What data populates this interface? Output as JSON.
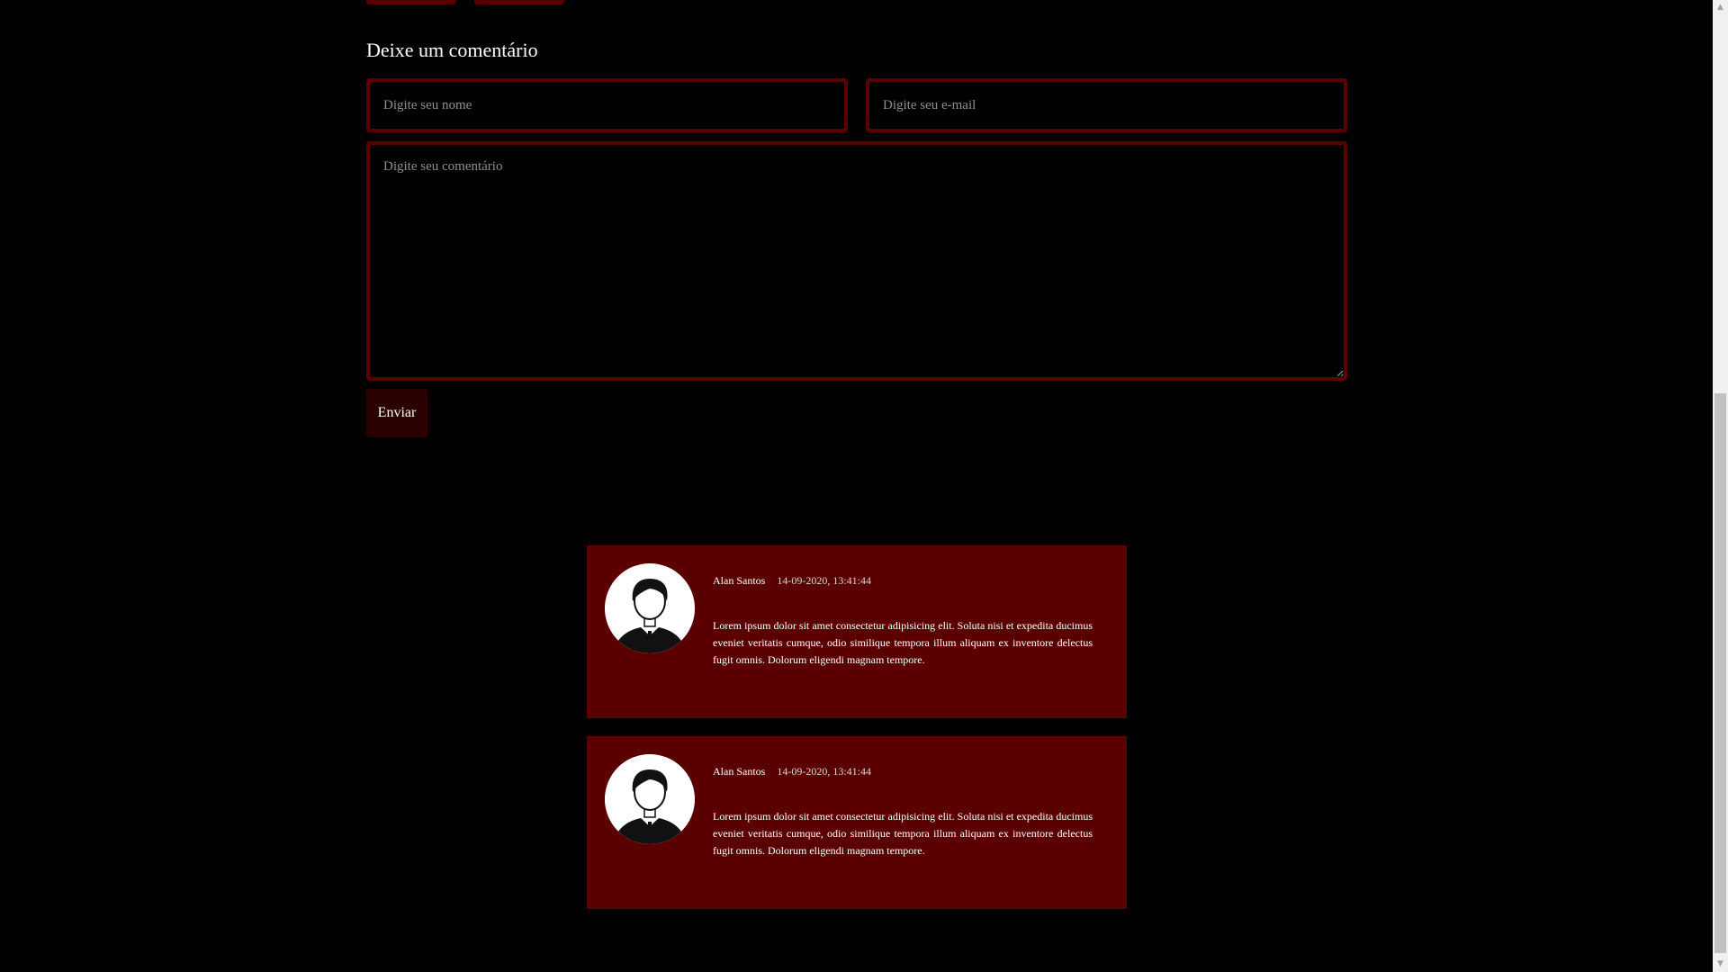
{
  "colors": {
    "background": "#000000",
    "accent": "#5a0000",
    "button": "#2a0000",
    "text": "#ffffff",
    "placeholder": "#8f8f8f"
  },
  "form": {
    "title": "Deixe um comentário",
    "name_placeholder": "Digite seu nome",
    "email_placeholder": "Digite seu e-mail",
    "comment_placeholder": "Digite seu comentário",
    "submit_label": "Enviar"
  },
  "comments": [
    {
      "author": "Alan Santos",
      "date": "14-09-2020, 13:41:44",
      "text": "Lorem ipsum dolor sit amet consectetur adipisicing elit. Soluta nisi et expedita ducimus eveniet veritatis cumque, odio similique tempora illum aliquam ex inventore delectus fugit omnis. Dolorum eligendi magnam tempore.",
      "avatar_icon": "user-avatar-icon"
    },
    {
      "author": "Alan Santos",
      "date": "14-09-2020, 13:41:44",
      "text": "Lorem ipsum dolor sit amet consectetur adipisicing elit. Soluta nisi et expedita ducimus eveniet veritatis cumque, odio similique tempora illum aliquam ex inventore delectus fugit omnis. Dolorum eligendi magnam tempore.",
      "avatar_icon": "user-avatar-icon"
    }
  ],
  "scrollbar": {
    "up_icon": "arrow-up-icon",
    "down_icon": "arrow-down-icon"
  }
}
